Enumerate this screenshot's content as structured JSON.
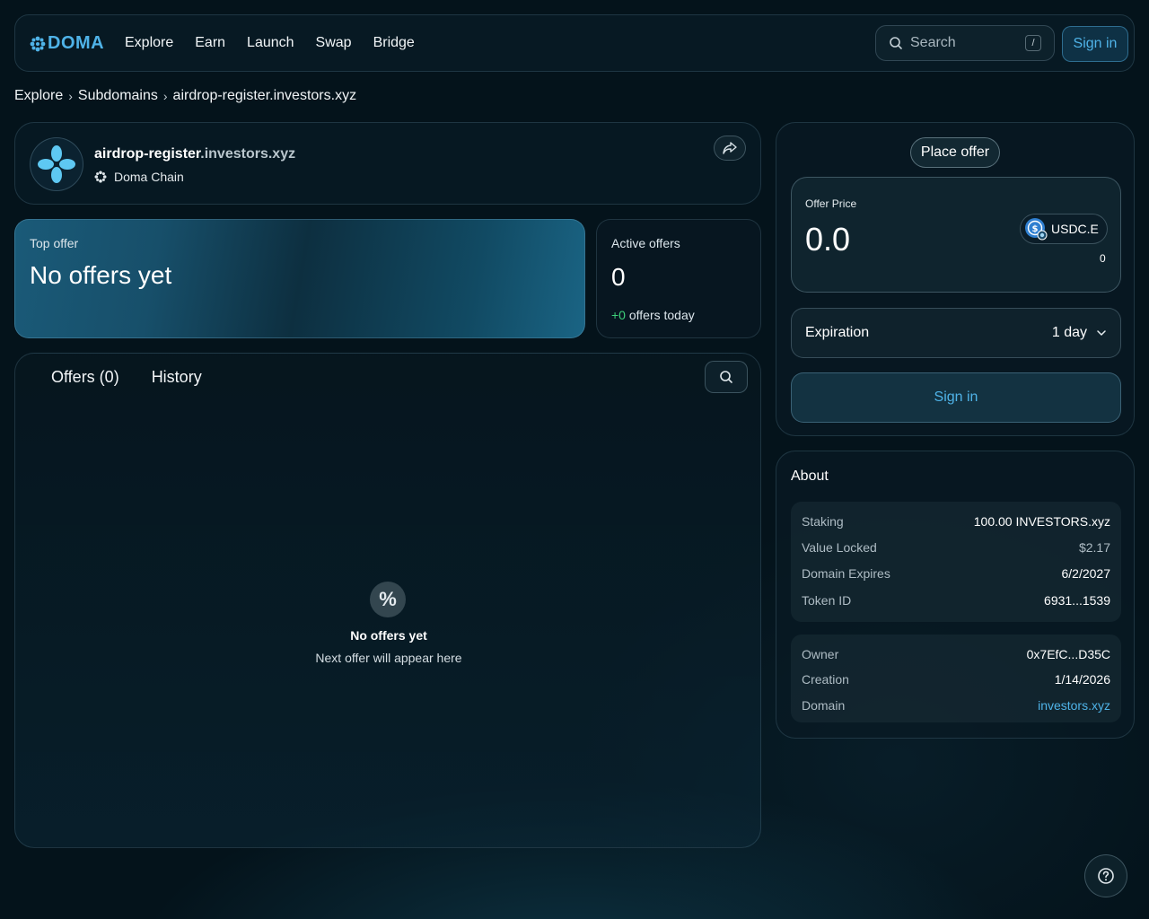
{
  "brand": {
    "name": "DOMA",
    "accent": "#4fb3e8"
  },
  "nav": {
    "items": [
      "Explore",
      "Earn",
      "Launch",
      "Swap",
      "Bridge"
    ]
  },
  "search": {
    "placeholder": "Search",
    "shortcut": "/"
  },
  "header": {
    "sign_in": "Sign in"
  },
  "breadcrumb": {
    "items": [
      "Explore",
      "Subdomains",
      "airdrop-register.investors.xyz"
    ]
  },
  "domain": {
    "name_prefix": "airdrop-register",
    "name_suffix": ".investors.xyz",
    "chain": "Doma Chain"
  },
  "top_offer": {
    "label": "Top offer",
    "value": "No offers yet"
  },
  "active_offers": {
    "label": "Active offers",
    "value": "0",
    "today_delta": "+0",
    "today_label": " offers today"
  },
  "offers": {
    "tabs": [
      "Offers (0)",
      "History"
    ],
    "empty_icon": "%",
    "empty_title": "No offers yet",
    "empty_subtitle": "Next offer will appear here"
  },
  "place_offer": {
    "title": "Place offer",
    "price_label": "Offer Price",
    "price_value": "0.0",
    "token": "USDC.E",
    "balance": "0",
    "expiration_label": "Expiration",
    "expiration_value": "1 day",
    "sign_in": "Sign in"
  },
  "about": {
    "title": "About",
    "group1": [
      {
        "key": "Staking",
        "value": "100.00 INVESTORS.xyz"
      },
      {
        "key": "Value Locked",
        "value": "$2.17"
      },
      {
        "key": "Domain Expires",
        "value": "6/2/2027"
      },
      {
        "key": "Token ID",
        "value": "6931...1539"
      }
    ],
    "group2": [
      {
        "key": "Owner",
        "value": "0x7EfC...D35C"
      },
      {
        "key": "Creation",
        "value": "1/14/2026"
      },
      {
        "key": "Domain",
        "value": "investors.xyz"
      }
    ]
  },
  "icons": {
    "logo": "doma-logo-icon",
    "search": "search-icon",
    "share": "share-icon",
    "chain": "doma-chain-icon",
    "dropdown": "chevron-down-icon",
    "help": "help-icon",
    "token": "usdc-icon"
  }
}
